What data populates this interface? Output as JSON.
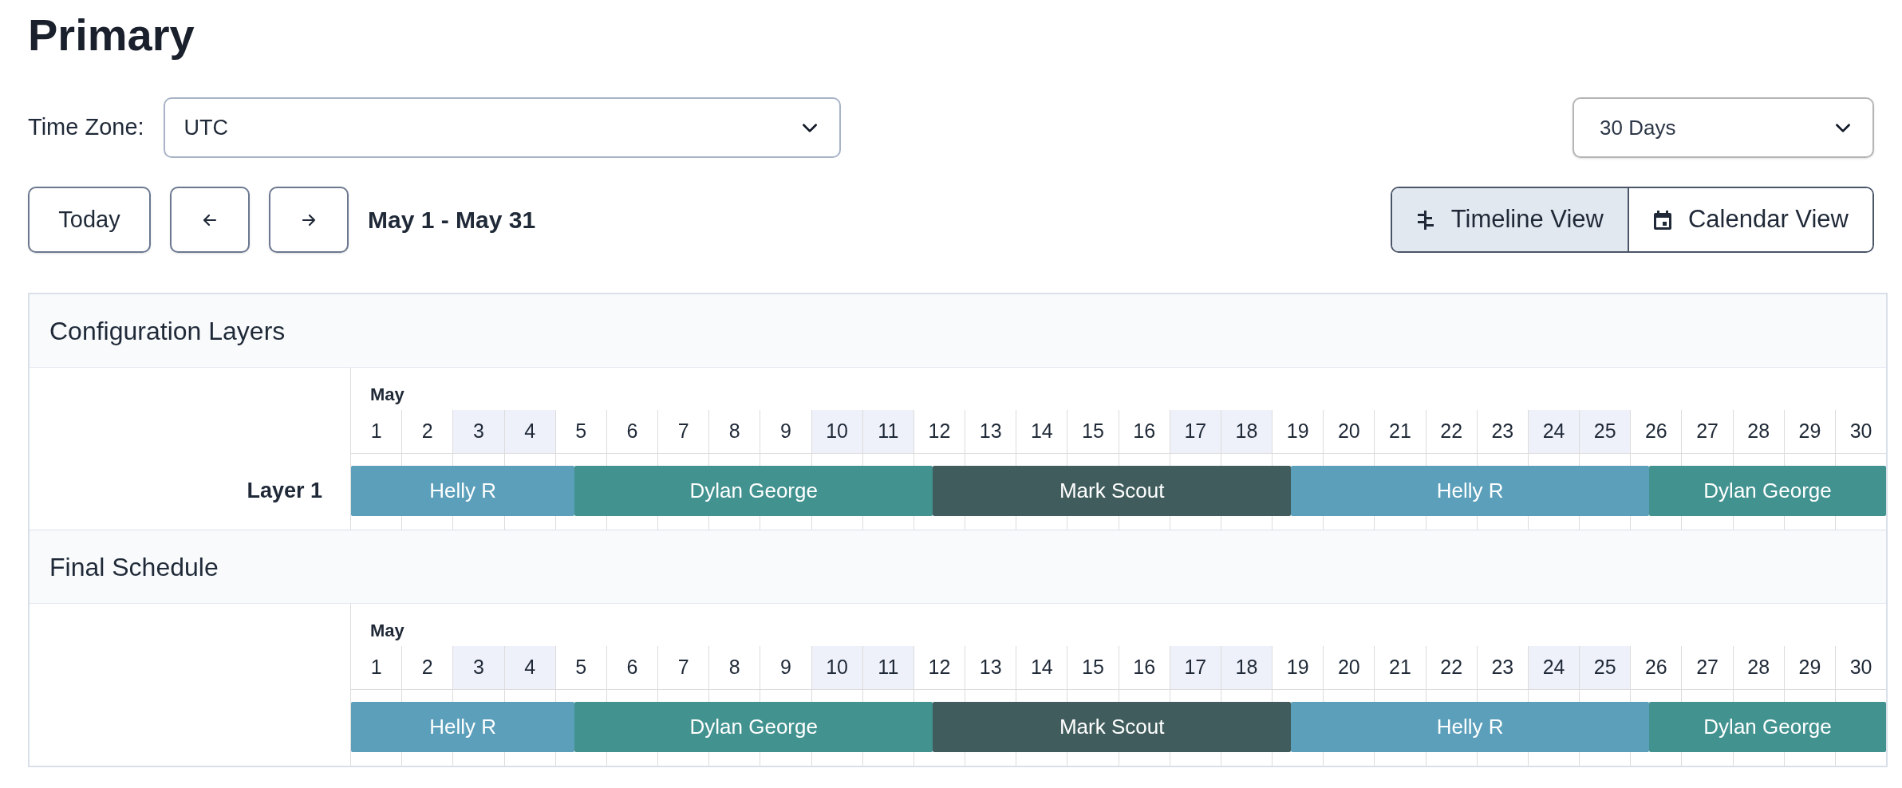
{
  "title": "Primary",
  "time_zone": {
    "label": "Time Zone:",
    "value": "UTC"
  },
  "range_select": {
    "value": "30 Days"
  },
  "nav": {
    "today": "Today",
    "range": "May 1 - May 31"
  },
  "views": [
    {
      "label": "Timeline View",
      "kind": "timeline",
      "selected": true
    },
    {
      "label": "Calendar View",
      "kind": "calendar",
      "selected": false
    }
  ],
  "sections": [
    {
      "title": "Configuration Layers",
      "month": "May",
      "days": [
        {
          "label": "1",
          "weekend": false
        },
        {
          "label": "2",
          "weekend": false
        },
        {
          "label": "3",
          "weekend": true
        },
        {
          "label": "4",
          "weekend": true
        },
        {
          "label": "5",
          "weekend": false
        },
        {
          "label": "6",
          "weekend": false
        },
        {
          "label": "7",
          "weekend": false
        },
        {
          "label": "8",
          "weekend": false
        },
        {
          "label": "9",
          "weekend": false
        },
        {
          "label": "10",
          "weekend": true
        },
        {
          "label": "11",
          "weekend": true
        },
        {
          "label": "12",
          "weekend": false
        },
        {
          "label": "13",
          "weekend": false
        },
        {
          "label": "14",
          "weekend": false
        },
        {
          "label": "15",
          "weekend": false
        },
        {
          "label": "16",
          "weekend": false
        },
        {
          "label": "17",
          "weekend": true
        },
        {
          "label": "18",
          "weekend": true
        },
        {
          "label": "19",
          "weekend": false
        },
        {
          "label": "20",
          "weekend": false
        },
        {
          "label": "21",
          "weekend": false
        },
        {
          "label": "22",
          "weekend": false
        },
        {
          "label": "23",
          "weekend": false
        },
        {
          "label": "24",
          "weekend": true
        },
        {
          "label": "25",
          "weekend": true
        },
        {
          "label": "26",
          "weekend": false
        },
        {
          "label": "27",
          "weekend": false
        },
        {
          "label": "28",
          "weekend": false
        },
        {
          "label": "29",
          "weekend": false
        },
        {
          "label": "30",
          "weekend": false
        }
      ],
      "rows": [
        {
          "label": "Layer 1",
          "bars": [
            {
              "name": "Helly R",
              "color": "#5b9fbb"
            },
            {
              "name": "Dylan George",
              "color": "#429290"
            },
            {
              "name": "Mark Scout",
              "color": "#405c5c"
            },
            {
              "name": "Helly R",
              "color": "#5b9fbb"
            },
            {
              "name": "Dylan George",
              "color": "#429290"
            }
          ]
        }
      ]
    },
    {
      "title": "Final Schedule",
      "month": "May",
      "days": [
        {
          "label": "1",
          "weekend": false
        },
        {
          "label": "2",
          "weekend": false
        },
        {
          "label": "3",
          "weekend": true
        },
        {
          "label": "4",
          "weekend": true
        },
        {
          "label": "5",
          "weekend": false
        },
        {
          "label": "6",
          "weekend": false
        },
        {
          "label": "7",
          "weekend": false
        },
        {
          "label": "8",
          "weekend": false
        },
        {
          "label": "9",
          "weekend": false
        },
        {
          "label": "10",
          "weekend": true
        },
        {
          "label": "11",
          "weekend": true
        },
        {
          "label": "12",
          "weekend": false
        },
        {
          "label": "13",
          "weekend": false
        },
        {
          "label": "14",
          "weekend": false
        },
        {
          "label": "15",
          "weekend": false
        },
        {
          "label": "16",
          "weekend": false
        },
        {
          "label": "17",
          "weekend": true
        },
        {
          "label": "18",
          "weekend": true
        },
        {
          "label": "19",
          "weekend": false
        },
        {
          "label": "20",
          "weekend": false
        },
        {
          "label": "21",
          "weekend": false
        },
        {
          "label": "22",
          "weekend": false
        },
        {
          "label": "23",
          "weekend": false
        },
        {
          "label": "24",
          "weekend": true
        },
        {
          "label": "25",
          "weekend": true
        },
        {
          "label": "26",
          "weekend": false
        },
        {
          "label": "27",
          "weekend": false
        },
        {
          "label": "28",
          "weekend": false
        },
        {
          "label": "29",
          "weekend": false
        },
        {
          "label": "30",
          "weekend": false
        }
      ],
      "rows": [
        {
          "bars": [
            {
              "name": "Helly R",
              "color": "#5b9fbb"
            },
            {
              "name": "Dylan George",
              "color": "#429290"
            },
            {
              "name": "Mark Scout",
              "color": "#405c5c"
            },
            {
              "name": "Helly R",
              "color": "#5b9fbb"
            },
            {
              "name": "Dylan George",
              "color": "#429290"
            }
          ]
        }
      ]
    }
  ]
}
